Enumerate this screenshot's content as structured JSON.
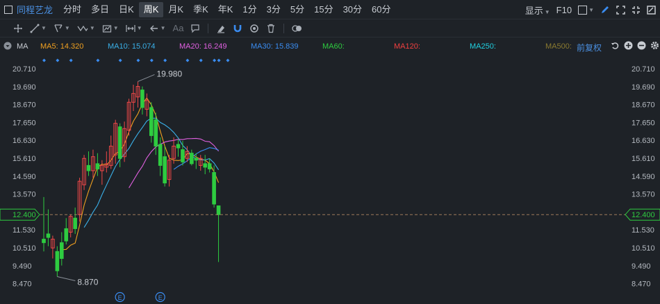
{
  "window": {
    "stock_name": "同程艺龙"
  },
  "periods": [
    "分时",
    "多日",
    "日K",
    "周K",
    "月K",
    "季K",
    "年K",
    "1分",
    "3分",
    "5分",
    "15分",
    "30分",
    "60分"
  ],
  "active_period": "周K",
  "top_right": {
    "display_label": "显示",
    "f10_label": "F10"
  },
  "toolbar": {
    "text_tool_label": "Aa"
  },
  "ma_bar": {
    "label": "MA",
    "items": [
      {
        "text": "MA5: 14.320",
        "color": "#f0a020"
      },
      {
        "text": "MA10: 15.074",
        "color": "#3ab0e8"
      },
      {
        "text": "MA20: 16.249",
        "color": "#e060e0"
      },
      {
        "text": "MA30: 15.839",
        "color": "#3a8cf0"
      },
      {
        "text": "MA60:",
        "color": "#2ecc40"
      },
      {
        "text": "MA120:",
        "color": "#f04040"
      },
      {
        "text": "MA250:",
        "color": "#20d0e0"
      },
      {
        "text": "MA500:",
        "color": "#8a7a30"
      }
    ],
    "adjust_label": "前复权"
  },
  "chart_data": {
    "type": "candlestick",
    "title": "",
    "xlabel": "",
    "ylabel": "",
    "y_ticks": [
      "20.710",
      "19.690",
      "18.670",
      "17.650",
      "16.630",
      "15.610",
      "14.590",
      "13.570",
      "12.400",
      "11.530",
      "10.510",
      "9.490",
      "8.470"
    ],
    "ylim": [
      8.47,
      20.71
    ],
    "current_price": "12.400",
    "high_annotation": "19.980",
    "low_annotation": "8.870",
    "event_markers": [
      "E",
      "E"
    ],
    "candles": [
      {
        "o": 11.0,
        "h": 13.4,
        "l": 10.3,
        "c": 10.8
      },
      {
        "o": 11.3,
        "h": 12.7,
        "l": 10.6,
        "c": 11.1
      },
      {
        "o": 10.5,
        "h": 11.2,
        "l": 9.9,
        "c": 11.0
      },
      {
        "o": 10.3,
        "h": 10.6,
        "l": 8.87,
        "c": 9.2
      },
      {
        "o": 10.8,
        "h": 11.4,
        "l": 9.5,
        "c": 9.9
      },
      {
        "o": 11.6,
        "h": 12.2,
        "l": 10.7,
        "c": 10.9
      },
      {
        "o": 11.4,
        "h": 12.4,
        "l": 11.1,
        "c": 12.3
      },
      {
        "o": 12.2,
        "h": 12.8,
        "l": 11.3,
        "c": 11.6
      },
      {
        "o": 12.4,
        "h": 14.5,
        "l": 12.0,
        "c": 14.3
      },
      {
        "o": 14.1,
        "h": 15.8,
        "l": 13.8,
        "c": 15.6
      },
      {
        "o": 15.2,
        "h": 16.0,
        "l": 14.6,
        "c": 14.9
      },
      {
        "o": 14.9,
        "h": 16.1,
        "l": 14.5,
        "c": 15.7
      },
      {
        "o": 15.3,
        "h": 15.9,
        "l": 14.6,
        "c": 15.0
      },
      {
        "o": 14.9,
        "h": 15.5,
        "l": 14.1,
        "c": 15.2
      },
      {
        "o": 15.1,
        "h": 16.0,
        "l": 14.8,
        "c": 15.3
      },
      {
        "o": 15.2,
        "h": 16.9,
        "l": 15.0,
        "c": 16.3
      },
      {
        "o": 15.8,
        "h": 17.8,
        "l": 15.3,
        "c": 17.6
      },
      {
        "o": 17.4,
        "h": 17.6,
        "l": 15.1,
        "c": 15.6
      },
      {
        "o": 15.7,
        "h": 17.7,
        "l": 15.4,
        "c": 17.3
      },
      {
        "o": 17.2,
        "h": 19.0,
        "l": 16.9,
        "c": 18.8
      },
      {
        "o": 18.8,
        "h": 19.8,
        "l": 18.3,
        "c": 19.3
      },
      {
        "o": 19.1,
        "h": 19.98,
        "l": 18.5,
        "c": 19.7
      },
      {
        "o": 19.5,
        "h": 19.7,
        "l": 18.1,
        "c": 18.5
      },
      {
        "o": 18.4,
        "h": 19.3,
        "l": 18.0,
        "c": 18.9
      },
      {
        "o": 18.5,
        "h": 18.8,
        "l": 16.5,
        "c": 16.9
      },
      {
        "o": 17.8,
        "h": 18.2,
        "l": 15.8,
        "c": 16.3
      },
      {
        "o": 16.4,
        "h": 16.8,
        "l": 14.6,
        "c": 15.2
      },
      {
        "o": 15.7,
        "h": 16.3,
        "l": 14.0,
        "c": 14.2
      },
      {
        "o": 14.4,
        "h": 15.8,
        "l": 14.0,
        "c": 15.5
      },
      {
        "o": 15.6,
        "h": 16.8,
        "l": 15.3,
        "c": 16.3
      },
      {
        "o": 16.4,
        "h": 16.7,
        "l": 15.7,
        "c": 16.2
      },
      {
        "o": 16.1,
        "h": 16.6,
        "l": 15.2,
        "c": 15.4
      },
      {
        "o": 15.6,
        "h": 16.3,
        "l": 15.4,
        "c": 16.0
      },
      {
        "o": 15.9,
        "h": 16.1,
        "l": 15.2,
        "c": 15.3
      },
      {
        "o": 15.6,
        "h": 15.9,
        "l": 15.0,
        "c": 15.5
      },
      {
        "o": 15.2,
        "h": 15.8,
        "l": 14.9,
        "c": 15.6
      },
      {
        "o": 15.3,
        "h": 15.8,
        "l": 14.7,
        "c": 15.1
      },
      {
        "o": 15.3,
        "h": 15.6,
        "l": 14.8,
        "c": 15.0
      },
      {
        "o": 14.8,
        "h": 15.2,
        "l": 12.8,
        "c": 13.0
      },
      {
        "o": 12.9,
        "h": 12.9,
        "l": 9.7,
        "c": 12.4
      }
    ]
  }
}
